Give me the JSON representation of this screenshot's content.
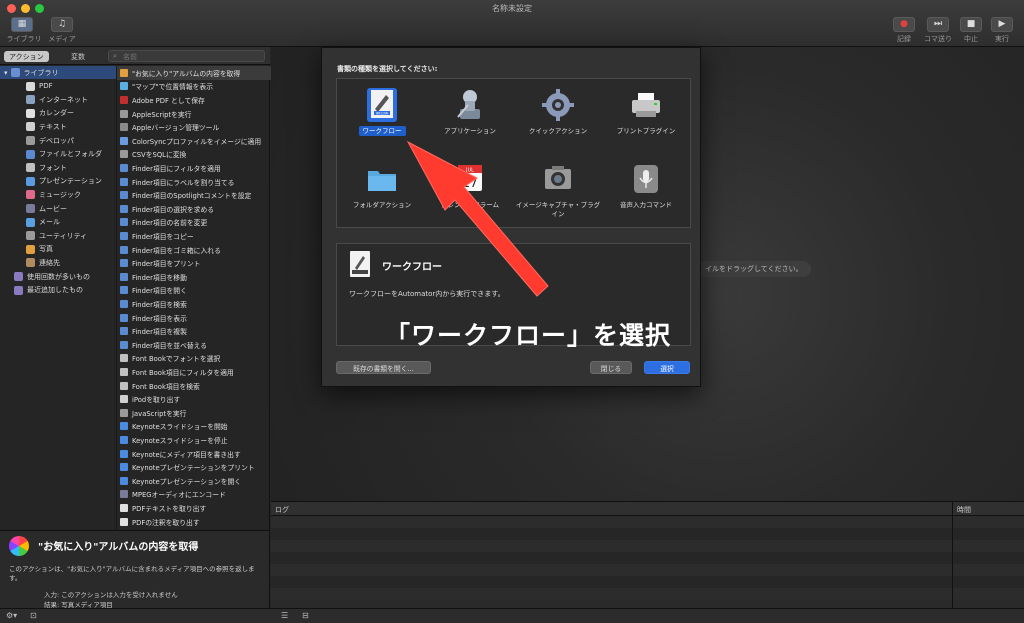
{
  "window": {
    "title": "名称未設定"
  },
  "toolbar": {
    "library_label": "ライブラリ",
    "media_label": "メディア",
    "record_label": "記録",
    "step_label": "コマ送り",
    "stop_label": "中止",
    "run_label": "実行"
  },
  "sidebar": {
    "tabs": [
      "アクション",
      "変数"
    ],
    "search_placeholder": "名前",
    "library": [
      {
        "label": "ライブラリ",
        "color": "#6a8fd0"
      },
      {
        "label": "PDF",
        "color": "#d9d9d9"
      },
      {
        "label": "インターネット",
        "color": "#8aa0c0"
      },
      {
        "label": "カレンダー",
        "color": "#e0e0e0"
      },
      {
        "label": "テキスト",
        "color": "#d0d0d0"
      },
      {
        "label": "デベロッパ",
        "color": "#9a9a9a"
      },
      {
        "label": "ファイルとフォルダ",
        "color": "#5a8ad0"
      },
      {
        "label": "フォント",
        "color": "#c0c0c0"
      },
      {
        "label": "プレゼンテーション",
        "color": "#5a9ae0"
      },
      {
        "label": "ミュージック",
        "color": "#e06a8a"
      },
      {
        "label": "ムービー",
        "color": "#7a7a9a"
      },
      {
        "label": "メール",
        "color": "#5aa0e0"
      },
      {
        "label": "ユーティリティ",
        "color": "#9a9a9a"
      },
      {
        "label": "写真",
        "color": "#e0a040"
      },
      {
        "label": "連絡先",
        "color": "#b08a60"
      },
      {
        "label": "使用回数が多いもの",
        "color": "#8a7ac0"
      },
      {
        "label": "最近追加したもの",
        "color": "#8a7ac0"
      }
    ],
    "actions": [
      "\"お気に入り\"アルバムの内容を取得",
      "\"マップ\"で位置情報を表示",
      "Adobe PDF として保存",
      "AppleScriptを実行",
      "Appleバージョン管理ツール",
      "ColorSyncプロファイルをイメージに適用",
      "CSVをSQLに変換",
      "Finder項目にフィルタを適用",
      "Finder項目にラベルを割り当てる",
      "Finder項目のSpotlightコメントを設定",
      "Finder項目の選択を求める",
      "Finder項目の名前を変更",
      "Finder項目をコピー",
      "Finder項目をゴミ箱に入れる",
      "Finder項目をプリント",
      "Finder項目を移動",
      "Finder項目を開く",
      "Finder項目を検索",
      "Finder項目を表示",
      "Finder項目を複製",
      "Finder項目を並べ替える",
      "Font Bookでフォントを選択",
      "Font Book項目にフィルタを適用",
      "Font Book項目を検索",
      "iPodを取り出す",
      "JavaScriptを実行",
      "Keynoteスライドショーを開始",
      "Keynoteスライドショーを停止",
      "Keynoteにメディア項目を書き出す",
      "Keynoteプレゼンテーションをプリント",
      "Keynoteプレゼンテーションを開く",
      "MPEGオーディオにエンコード",
      "PDFテキストを取り出す",
      "PDFの注釈を取り出す"
    ]
  },
  "description": {
    "title": "\"お気に入り\"アルバムの内容を取得",
    "text": "このアクションは、\"お気に入り\"アルバムに含まれるメディア項目への参照を返します。",
    "input": "入力: このアクションは入力を受け入れません",
    "result": "結果: 写真メディア項目"
  },
  "workflow": {
    "drop_hint": "イルをドラッグしてください。",
    "log_col": "ログ",
    "time_col": "時間"
  },
  "dialog": {
    "heading": "書類の種類を選択してください:",
    "types": [
      {
        "label": "ワークフロー",
        "icon": "workflow-icon"
      },
      {
        "label": "アプリケーション",
        "icon": "application-icon"
      },
      {
        "label": "クイックアクション",
        "icon": "quick-action-icon"
      },
      {
        "label": "プリントプラグイン",
        "icon": "print-plugin-icon"
      },
      {
        "label": "フォルダアクション",
        "icon": "folder-action-icon"
      },
      {
        "label": "カレンダーアラーム",
        "icon": "calendar-alarm-icon"
      },
      {
        "label": "イメージキャプチャ・プラグイン",
        "icon": "image-capture-icon"
      },
      {
        "label": "音声入力コマンド",
        "icon": "dictation-icon"
      }
    ],
    "selected_title": "ワークフロー",
    "selected_text": "ワークフローをAutomator内から実行できます。",
    "open_existing": "既存の書類を開く...",
    "close": "閉じる",
    "choose": "選択"
  },
  "annotation": "「ワークフロー」を選択",
  "colors": {
    "accent": "#2d6fe0",
    "arrow": "#ff3b30"
  }
}
